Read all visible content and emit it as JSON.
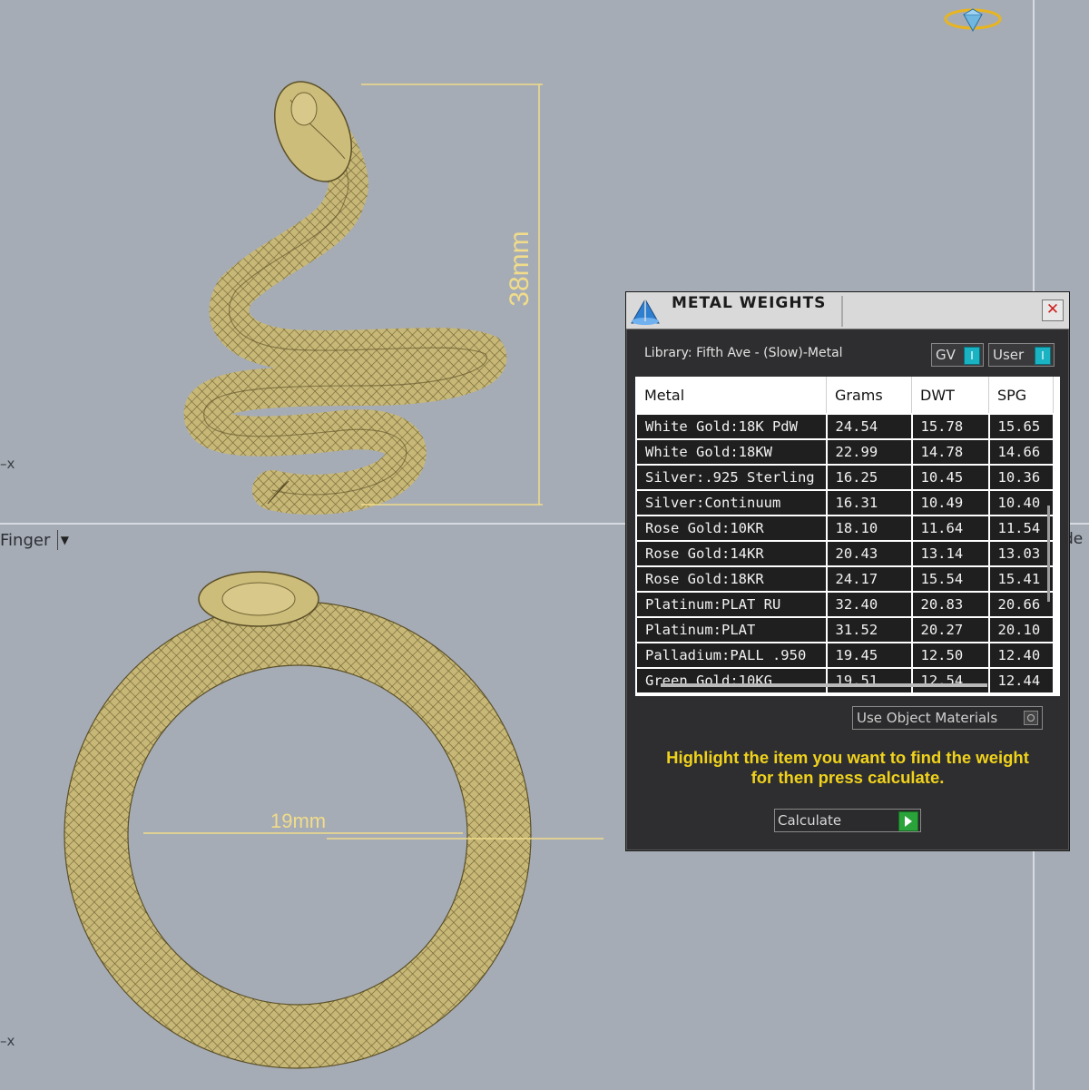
{
  "viewport": {
    "axis_top": "x",
    "axis_bottom": "x",
    "view_label": "Finger",
    "side_text": "de",
    "dimension_height": "38mm",
    "dimension_diameter": "19mm"
  },
  "dialog": {
    "title": "METAL WEIGHTS",
    "close_symbol": "✕",
    "library": "Library: Fifth Ave - (Slow)-Metal",
    "toggle_gv": "GV",
    "toggle_user": "User",
    "toggle_knob": "I",
    "columns": [
      "Metal",
      "Grams",
      "DWT",
      "SPG"
    ],
    "rows": [
      [
        "White Gold:18K PdW",
        "24.54",
        "15.78",
        "15.65"
      ],
      [
        "White Gold:18KW",
        "22.99",
        "14.78",
        "14.66"
      ],
      [
        "Silver:.925 Sterling",
        "16.25",
        "10.45",
        "10.36"
      ],
      [
        "Silver:Continuum",
        "16.31",
        "10.49",
        "10.40"
      ],
      [
        "Rose Gold:10KR",
        "18.10",
        "11.64",
        "11.54"
      ],
      [
        "Rose Gold:14KR",
        "20.43",
        "13.14",
        "13.03"
      ],
      [
        "Rose Gold:18KR",
        "24.17",
        "15.54",
        "15.41"
      ],
      [
        "Platinum:PLAT RU",
        "32.40",
        "20.83",
        "20.66"
      ],
      [
        "Platinum:PLAT",
        "31.52",
        "20.27",
        "20.10"
      ],
      [
        "Palladium:PALL .950",
        "19.45",
        "12.50",
        "12.40"
      ],
      [
        "Green Gold:10KG",
        "19.51",
        "12.54",
        "12.44"
      ]
    ],
    "use_object_materials": "Use Object Materials",
    "hint_line1": "Highlight the item you want to find the weight",
    "hint_line2": "for then press calculate.",
    "calculate_label": "Calculate"
  },
  "colors": {
    "viewport_bg": "#a6acb5",
    "gold": "#c9b977",
    "dimension_line": "#f0dc8a",
    "hint_text": "#f0d21c",
    "toggle_accent": "#19b3c3",
    "go_button": "#2aa33a"
  }
}
